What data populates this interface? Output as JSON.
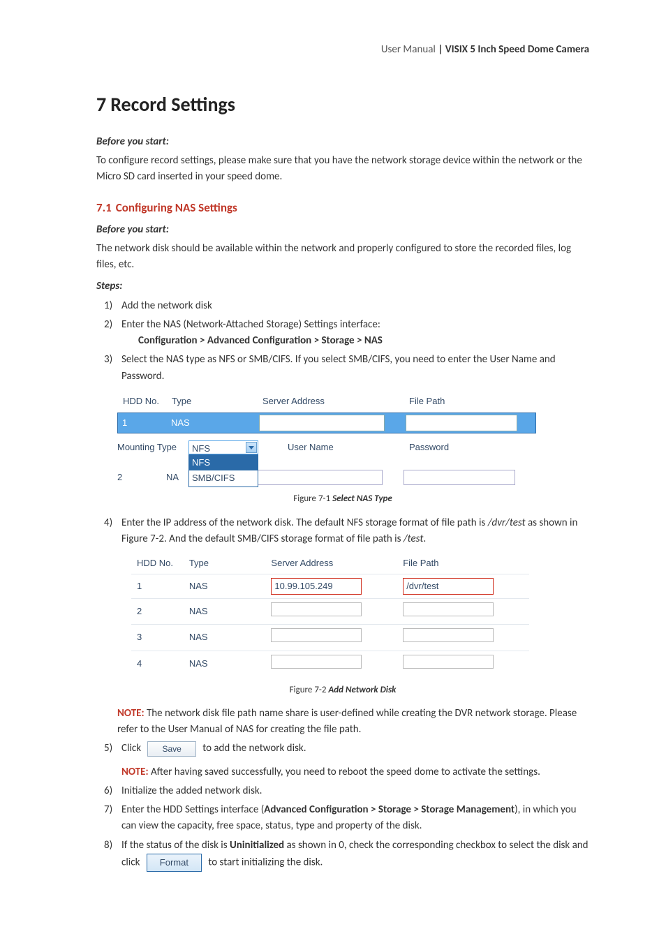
{
  "header": {
    "left": "User Manual",
    "sep": " | ",
    "right": "VISIX 5 Inch Speed Dome Camera"
  },
  "chapter": {
    "num": "7",
    "title": "Record Settings"
  },
  "intro": {
    "bys": "Before you start:",
    "p1": "To configure record settings, please make sure that you have the network storage device within the network or the Micro SD card inserted in your speed dome."
  },
  "section": {
    "num": "7.1",
    "title": "Configuring NAS Settings",
    "bys": "Before you start:",
    "p1": "The network disk should be available within the network and properly configured to store the recorded files, log files, etc.",
    "steps_label": "Steps:"
  },
  "steps": {
    "s1": "Add the network disk",
    "s2": "Enter the NAS (Network-Attached Storage) Settings interface:",
    "s2_path": "Configuration > Advanced Configuration > Storage > NAS",
    "s3": "Select the NAS type as NFS or SMB/CIFS. If you select SMB/CIFS, you need to enter the User Name and Password.",
    "s4a": "Enter the IP address of the network disk. The default NFS storage format of file path is ",
    "s4b": "/dvr/test",
    "s4c": " as shown in Figure 7-2. And the default SMB/CIFS storage format of file path is ",
    "s4d": "/test",
    "s4e": ".",
    "note1_label": "NOTE:",
    "note1_text": " The network disk file path name share is user-defined while creating the DVR network storage. Please refer to the User Manual of NAS for creating the file path.",
    "s5a": "Click ",
    "s5_btn": "Save",
    "s5b": " to add the network disk.",
    "note2_label": "NOTE:",
    "note2_text": " After having saved successfully, you need to reboot the speed dome to activate the settings.",
    "s6": "Initialize the added network disk.",
    "s7a": "Enter the HDD Settings interface (",
    "s7b": "Advanced Configuration > Storage > Storage Management",
    "s7c": "), in which you can view the capacity, free space, status, type and property of the disk.",
    "s8a": "If the status of the disk is ",
    "s8b": "Uninitialized",
    "s8c": " as shown in 0, check the corresponding checkbox to select the disk and click ",
    "s8_btn": "Format",
    "s8d": " to start initializing the disk."
  },
  "fig1": {
    "caption_num": "Figure 7-1 ",
    "caption_title": "Select NAS Type",
    "hdd_no": "HDD No.",
    "type": "Type",
    "server_address": "Server Address",
    "file_path": "File Path",
    "row1_no": "1",
    "row1_type": "NAS",
    "mounting_type": "Mounting Type",
    "mt_value": "NFS",
    "mt_opt1": "NFS",
    "mt_opt2": "SMB/CIFS",
    "user_name": "User Name",
    "password": "Password",
    "row2_no": "2",
    "row2_na": "NA"
  },
  "fig2": {
    "caption_num": "Figure 7-2 ",
    "caption_title": "Add Network Disk",
    "hdd_no": "HDD No.",
    "type": "Type",
    "server_address": "Server Address",
    "file_path": "File Path",
    "rows": [
      {
        "no": "1",
        "type": "NAS",
        "sa": "10.99.105.249",
        "fp": "/dvr/test",
        "hl": true
      },
      {
        "no": "2",
        "type": "NAS",
        "sa": "",
        "fp": "",
        "hl": false
      },
      {
        "no": "3",
        "type": "NAS",
        "sa": "",
        "fp": "",
        "hl": false
      },
      {
        "no": "4",
        "type": "NAS",
        "sa": "",
        "fp": "",
        "hl": false
      }
    ]
  }
}
